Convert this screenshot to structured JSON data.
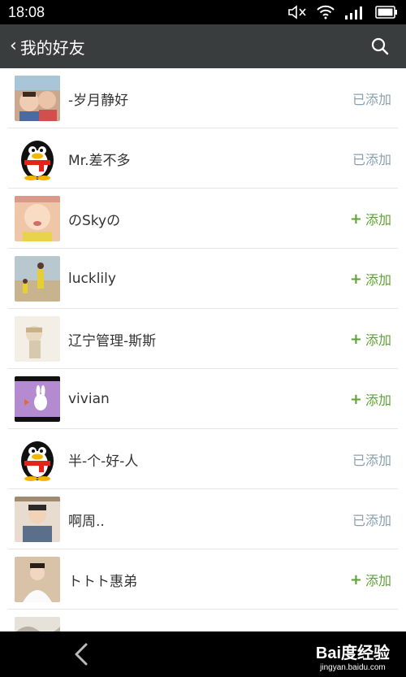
{
  "status_bar": {
    "time": "18:08"
  },
  "header": {
    "back_glyph": "‹",
    "title": "我的好友"
  },
  "colors": {
    "header_bg": "#3a3d3e",
    "add_green": "#5ea334",
    "added_gray": "#8aa0ae"
  },
  "friends": [
    {
      "name": "-岁月静好",
      "action": "已添加",
      "status": "added"
    },
    {
      "name": "Mr.差不多",
      "action": "已添加",
      "status": "added"
    },
    {
      "name": "のSkyの",
      "action": "添加",
      "status": "add"
    },
    {
      "name": "lucklily",
      "action": "添加",
      "status": "add"
    },
    {
      "name": "辽宁管理-斯斯",
      "action": "添加",
      "status": "add"
    },
    {
      "name": "vivian",
      "action": "添加",
      "status": "add"
    },
    {
      "name": "半-个-好-人",
      "action": "已添加",
      "status": "added"
    },
    {
      "name": "啊周..",
      "action": "已添加",
      "status": "added"
    },
    {
      "name": "トトト惠弟",
      "action": "添加",
      "status": "add"
    }
  ],
  "watermark": {
    "main": "Bai度经验",
    "sub": "jingyan.baidu.com"
  }
}
